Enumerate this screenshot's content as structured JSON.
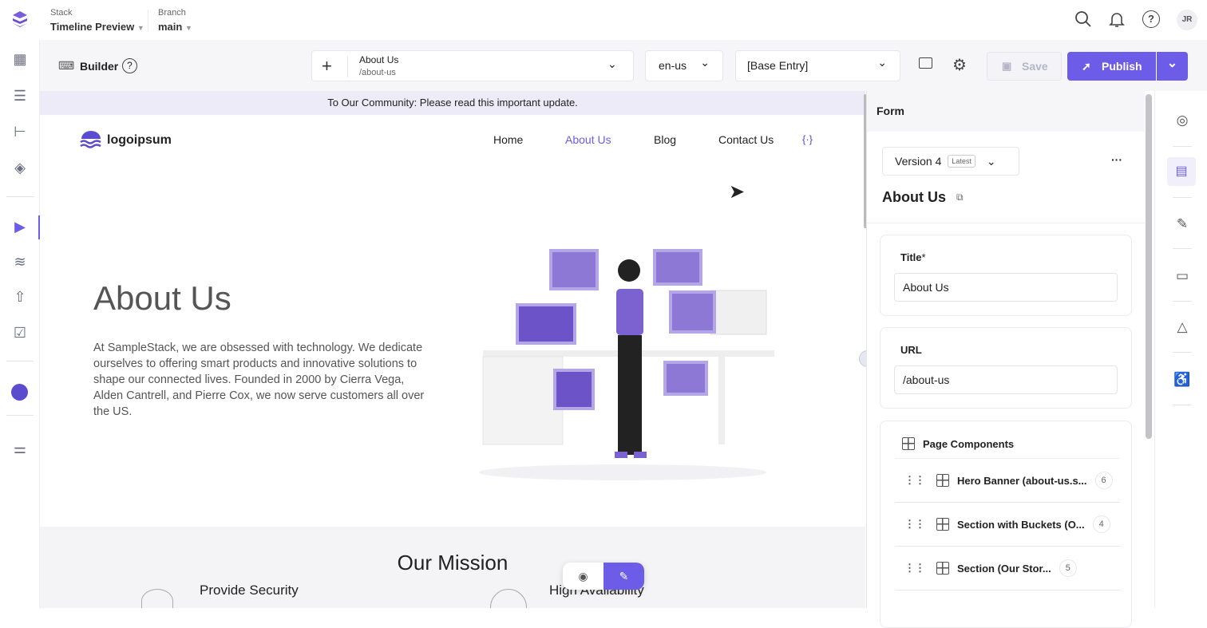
{
  "topbar": {
    "stack_label": "Stack",
    "stack_value": "Timeline Preview",
    "branch_label": "Branch",
    "branch_value": "main",
    "avatar": "JR"
  },
  "toolbar": {
    "builder_label": "Builder",
    "entry_title": "About Us",
    "entry_url": "/about-us",
    "locale": "en-us",
    "base_entry": "[Base Entry]",
    "save_label": "Save",
    "publish_label": "Publish"
  },
  "preview": {
    "banner": "To Our Community: Please read this important update.",
    "logo": "logoipsum",
    "nav": [
      "Home",
      "About Us",
      "Blog",
      "Contact Us",
      "{·}"
    ],
    "hero_title": "About Us",
    "hero_text": "At SampleStack, we are obsessed with technology. We dedicate ourselves to offering smart products and innovative solutions to shape our connected lives. Founded in 2000 by Cierra Vega, Alden Cantrell, and Pierre Cox, we now serve customers all over the US.",
    "mission_title": "Our Mission",
    "mission_items": [
      "Provide Security",
      "High Availability"
    ]
  },
  "form": {
    "header": "Form",
    "version": "Version 4",
    "version_badge": "Latest",
    "entry_title": "About Us",
    "title_label": "Title",
    "title_required": "*",
    "title_value": "About Us",
    "url_label": "URL",
    "url_value": "/about-us",
    "components_label": "Page Components",
    "components": [
      {
        "name": "Hero Banner (about-us.s...",
        "count": "6"
      },
      {
        "name": "Section with Buckets (O...",
        "count": "4"
      },
      {
        "name": "Section (Our Stor...",
        "count": "5"
      }
    ]
  },
  "colors": {
    "accent": "#6c5ce7",
    "banner": "#ecebf7"
  }
}
